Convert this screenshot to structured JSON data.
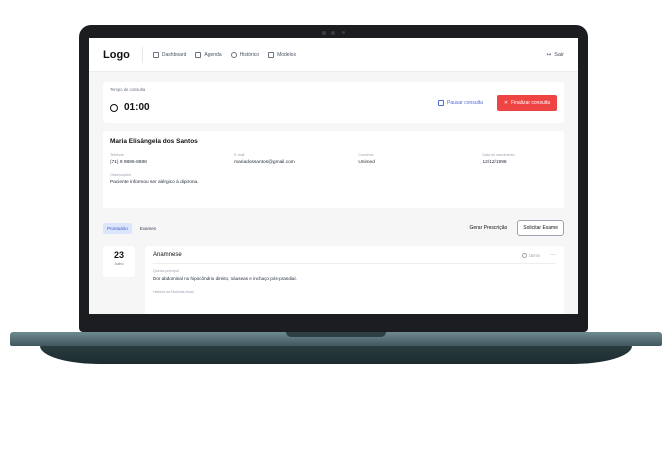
{
  "app": {
    "logo": "Logo",
    "logout_label": "Sair"
  },
  "nav": [
    {
      "label": "Dashboard",
      "icon": "grid-icon"
    },
    {
      "label": "Agenda",
      "icon": "calendar-icon"
    },
    {
      "label": "Histórico",
      "icon": "history-icon"
    },
    {
      "label": "Modelos",
      "icon": "document-icon"
    }
  ],
  "timer": {
    "label": "Tempo de consulta",
    "value": "01:00",
    "pause_label": "Pausar consulta",
    "finish_label": "Finalizar consulta"
  },
  "patient": {
    "name": "Maria Elisângela dos Santos",
    "fields": [
      {
        "label": "Telefone",
        "value": "(71) 9 9886-8888"
      },
      {
        "label": "E-mail",
        "value": "mariadossantos@gmail.com"
      },
      {
        "label": "Convênio",
        "value": "Unimed"
      },
      {
        "label": "Data de nascimento",
        "value": "12/12/1998"
      }
    ],
    "obs_label": "Observações",
    "obs_value": "Paciente informou ser alérgico à dipirona."
  },
  "tabs": [
    "Prontuário",
    "Exames"
  ],
  "actions": {
    "generate": "Gerar Prescrição",
    "request": "Solicitar Exame"
  },
  "entry": {
    "day": "23",
    "month": "Julho",
    "title": "Anamnese",
    "duration": "15min",
    "more": "···",
    "q1_label": "Queixa principal",
    "q1_value": "Dor abdominal no hipocôndrio direito, náuseas e inchaço pós-prandial.",
    "q2_label": "História da Moléstia Atual"
  },
  "colors": {
    "accent": "#4f6bd8",
    "danger": "#ef4444",
    "laptop_base": "#4f676d"
  }
}
